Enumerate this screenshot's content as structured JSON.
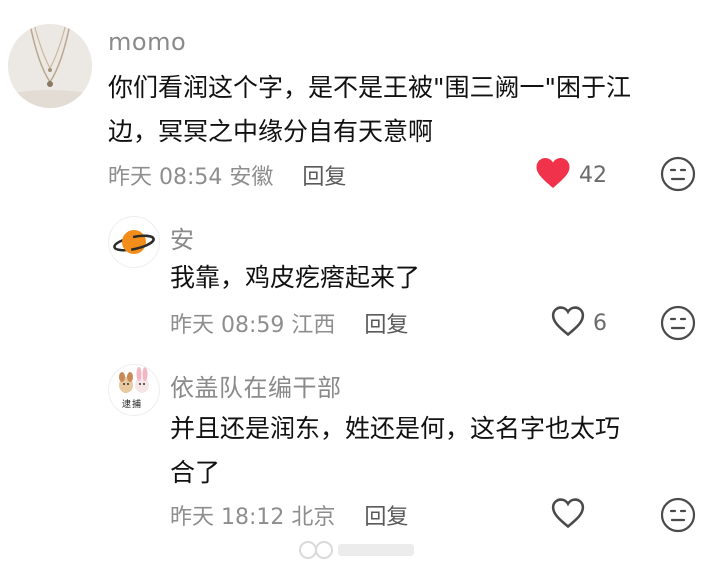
{
  "comments": [
    {
      "username": "momo",
      "text_line1": "你们看润这个字，是不是王被\"围三阙一\"困于江",
      "text_line2": "边，冥冥之中缘分自有天意啊",
      "date": "昨天 08:54",
      "location": "安徽",
      "reply_label": "回复",
      "like_count": "42",
      "liked": true
    }
  ],
  "replies": [
    {
      "username": "安",
      "text_line1": "我靠，鸡皮疙瘩起来了",
      "date": "昨天 08:59",
      "location": "江西",
      "reply_label": "回复",
      "like_count": "6",
      "liked": false
    },
    {
      "username": "依盖队在编干部",
      "text_line1": "并且还是润东，姓还是何，这名字也太巧",
      "text_line2": "合了",
      "date": "昨天 18:12",
      "location": "北京",
      "reply_label": "回复",
      "like_count": "",
      "liked": false,
      "avatar_caption": "逮捕"
    }
  ],
  "colors": {
    "like_red": "#f0324a",
    "meta_gray": "#8e8e8e",
    "name_gray": "#8a8a8a"
  },
  "icons": [
    "heart-filled-icon",
    "heart-outline-icon",
    "dislike-face-icon",
    "planet-icon"
  ]
}
